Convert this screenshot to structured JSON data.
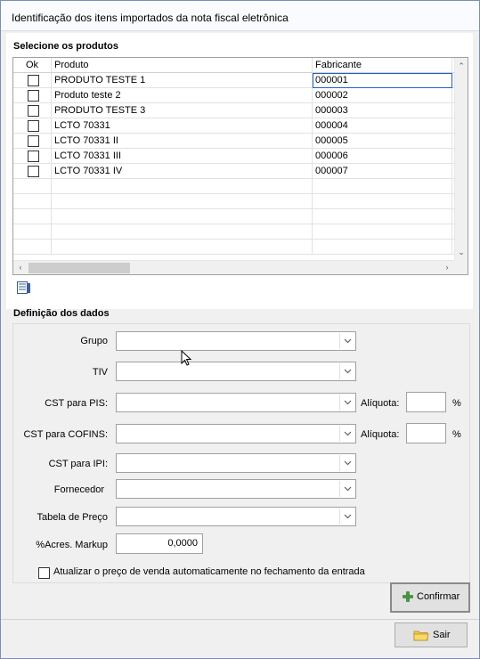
{
  "window": {
    "title": "Identificação dos itens importados da nota fiscal eletrônica"
  },
  "products_section": {
    "label": "Selecione os produtos",
    "columns": {
      "ok": "Ok",
      "produto": "Produto",
      "fabricante": "Fabricante"
    },
    "rows": [
      {
        "produto": "PRODUTO TESTE 1",
        "fabricante": "000001",
        "checked": false
      },
      {
        "produto": "Produto teste 2",
        "fabricante": "000002",
        "checked": false
      },
      {
        "produto": "PRODUTO TESTE 3",
        "fabricante": "000003",
        "checked": false
      },
      {
        "produto": "LCTO 70331",
        "fabricante": "000004",
        "checked": false
      },
      {
        "produto": "LCTO 70331 II",
        "fabricante": "000005",
        "checked": false
      },
      {
        "produto": "LCTO 70331 III",
        "fabricante": "000006",
        "checked": false
      },
      {
        "produto": "LCTO 70331 IV",
        "fabricante": "000007",
        "checked": false
      }
    ]
  },
  "data_section": {
    "label": "Definição dos dados",
    "grupo_label": "Grupo",
    "tiv_label": "TIV",
    "cst_pis_label": "CST para PIS:",
    "cst_cofins_label": "CST para COFINS:",
    "cst_ipi_label": "CST para IPI:",
    "fornecedor_label": "Fornecedor",
    "tabela_preco_label": "Tabela de Preço",
    "markup_label": "%Acres. Markup",
    "markup_value": "0,0000",
    "aliquota_label": "Alíquota:",
    "percent_symbol": "%",
    "auto_update_label": "Atualizar o preço de venda automaticamente no fechamento da entrada"
  },
  "buttons": {
    "confirmar": "Confirmar",
    "sair": "Sair"
  }
}
